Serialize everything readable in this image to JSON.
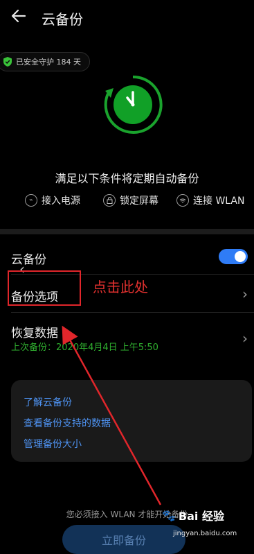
{
  "header": {
    "title": "云备份"
  },
  "status_badge": {
    "text": "已安全守护 184 天"
  },
  "conditions": {
    "title": "满足以下条件将定期自动备份",
    "items": [
      {
        "label": "接入电源",
        "icon": "power-plug-icon"
      },
      {
        "label": "锁定屏幕",
        "icon": "lock-icon"
      },
      {
        "label": "连接 WLAN",
        "icon": "wifi-icon"
      }
    ]
  },
  "settings": {
    "cloud_backup_label": "云备份",
    "cloud_backup_enabled": true,
    "backup_options_label": "备份选项",
    "restore_label": "恢复数据",
    "last_backup": "上次备份：2020年4月4日 上午5:50"
  },
  "links": [
    {
      "label": "了解云备份"
    },
    {
      "label": "查看备份支持的数据"
    },
    {
      "label": "管理备份大小"
    }
  ],
  "footer": {
    "note": "您必须接入 WLAN 才能开始备份",
    "button_label": "立即备份"
  },
  "annotation": {
    "text": "点击此处",
    "color": "#e3312f"
  },
  "watermark": {
    "text": "Bai 经验",
    "sub": "jingyan.baidu.com"
  },
  "colors": {
    "accent": "#2f7cf6",
    "success": "#2fb02f",
    "clock_green": "#1aa32d"
  }
}
